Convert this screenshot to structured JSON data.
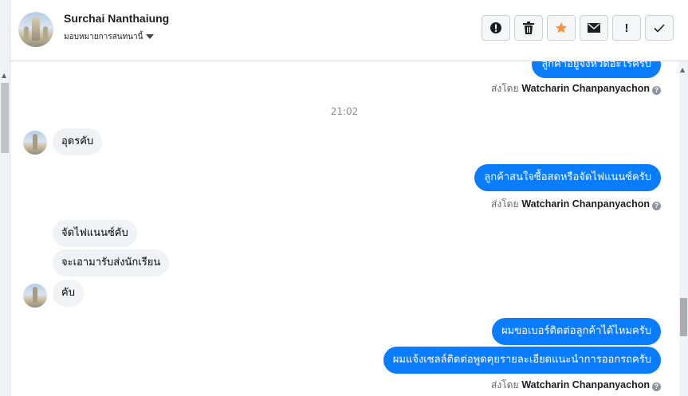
{
  "header": {
    "contact_name": "Surchai Nanthaiung",
    "assign_label": "มอบหมายการสนทนานี้",
    "actions": [
      {
        "name": "alert-icon"
      },
      {
        "name": "trash-icon"
      },
      {
        "name": "star-icon",
        "color": "#f7923a"
      },
      {
        "name": "mail-icon"
      },
      {
        "name": "exclamation-icon",
        "label": "!"
      },
      {
        "name": "check-icon"
      }
    ]
  },
  "thread": {
    "messages": [
      {
        "dir": "out",
        "text": "ลูกค้าอยู่จังหวัดอะไรครับ"
      },
      {
        "dir": "meta",
        "prefix": "ส่งโดย",
        "agent": "Watcharin Chanpanyachon",
        "help": "?"
      },
      {
        "dir": "time",
        "text": "21:02"
      },
      {
        "dir": "in",
        "text": "อุดรคับ"
      },
      {
        "dir": "out",
        "text": "ลูกค้าสนใจซื้อสดหรือจัดไฟแนนซ์ครับ"
      },
      {
        "dir": "meta",
        "prefix": "ส่งโดย",
        "agent": "Watcharin Chanpanyachon",
        "help": "?"
      },
      {
        "dir": "in",
        "text": "จัดไฟแนนซ์คับ"
      },
      {
        "dir": "in",
        "text": "จะเอามารับส่งนักเรียน"
      },
      {
        "dir": "in",
        "text": "คับ"
      },
      {
        "dir": "out",
        "text": "ผมขอเบอร์ติดต่อลูกค้าได้ไหมครับ"
      },
      {
        "dir": "out",
        "text": "ผมแจ้งเซลล์ติดต่อพูดคุยรายละเอียดแนะนำการออกรถครับ"
      },
      {
        "dir": "meta",
        "prefix": "ส่งโดย",
        "agent": "Watcharin Chanpanyachon",
        "help": "?"
      }
    ]
  },
  "colors": {
    "outgoing_bubble": "#0a7cff",
    "incoming_bubble": "#f0f2f5",
    "accent_star": "#f7923a"
  }
}
